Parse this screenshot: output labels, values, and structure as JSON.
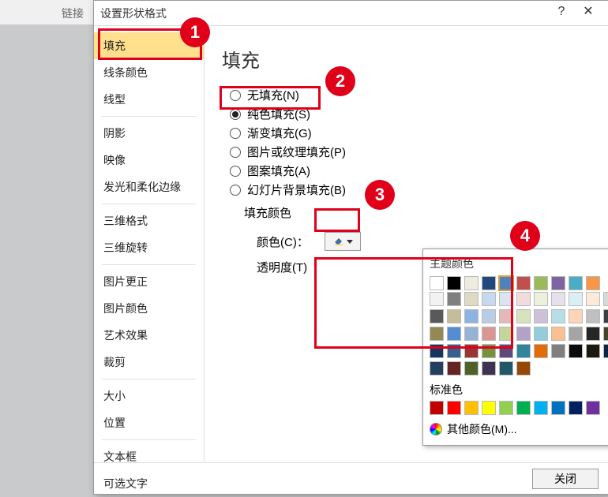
{
  "ribbon": {
    "left_text": "链接"
  },
  "dialog": {
    "title": "设置形状格式",
    "help": "?",
    "close_x": "✕"
  },
  "sidebar": {
    "groups": [
      [
        "填充",
        "线条颜色",
        "线型"
      ],
      [
        "阴影",
        "映像",
        "发光和柔化边缘"
      ],
      [
        "三维格式",
        "三维旋转"
      ],
      [
        "图片更正",
        "图片颜色",
        "艺术效果",
        "裁剪"
      ],
      [
        "大小",
        "位置"
      ],
      [
        "文本框",
        "可选文字"
      ]
    ],
    "selected": "填充"
  },
  "content": {
    "title": "填充",
    "radios": [
      {
        "label": "无填充(N)",
        "checked": false
      },
      {
        "label": "纯色填充(S)",
        "checked": true
      },
      {
        "label": "渐变填充(G)",
        "checked": false
      },
      {
        "label": "图片或纹理填充(P)",
        "checked": false
      },
      {
        "label": "图案填充(A)",
        "checked": false
      },
      {
        "label": "幻灯片背景填充(B)",
        "checked": false
      }
    ],
    "fill_color_sub": "填充颜色",
    "color_label": "颜色(C)：",
    "transparency_label": "透明度(T)"
  },
  "popup": {
    "theme_title": "主题颜色",
    "theme_row": [
      "#ffffff",
      "#000000",
      "#eeece1",
      "#1f497d",
      "#4f81bd",
      "#c0504d",
      "#9bbb59",
      "#8064a2",
      "#4bacc6",
      "#f79646"
    ],
    "shades": [
      [
        "#f2f2f2",
        "#7f7f7f",
        "#ddd9c3",
        "#c6d9f0",
        "#dbe5f1",
        "#f2dcdb",
        "#ebf1dd",
        "#e5e0ec",
        "#dbeef3",
        "#fdeada"
      ],
      [
        "#d8d8d8",
        "#595959",
        "#c4bd97",
        "#8db3e2",
        "#b8cce4",
        "#e5b9b7",
        "#d7e3bc",
        "#ccc1d9",
        "#b7dde8",
        "#fbd5b5"
      ],
      [
        "#bfbfbf",
        "#3f3f3f",
        "#938953",
        "#548dd4",
        "#95b3d7",
        "#d99694",
        "#c3d69b",
        "#b2a2c7",
        "#92cddc",
        "#fac08f"
      ],
      [
        "#a5a5a5",
        "#262626",
        "#494429",
        "#17365d",
        "#366092",
        "#953734",
        "#76923c",
        "#5f497a",
        "#31859b",
        "#e36c09"
      ],
      [
        "#7f7f7f",
        "#0c0c0c",
        "#1d1b10",
        "#0f243e",
        "#244061",
        "#632423",
        "#4f6128",
        "#3f3151",
        "#205867",
        "#974806"
      ]
    ],
    "standard_title": "标准色",
    "standard": [
      "#c00000",
      "#ff0000",
      "#ffc000",
      "#ffff00",
      "#92d050",
      "#00b050",
      "#00b0f0",
      "#0070c0",
      "#002060",
      "#7030a0"
    ],
    "more_colors": "其他颜色(M)..."
  },
  "footer": {
    "close": "关闭"
  },
  "annotations": {
    "b1": "1",
    "b2": "2",
    "b3": "3",
    "b4": "4"
  }
}
